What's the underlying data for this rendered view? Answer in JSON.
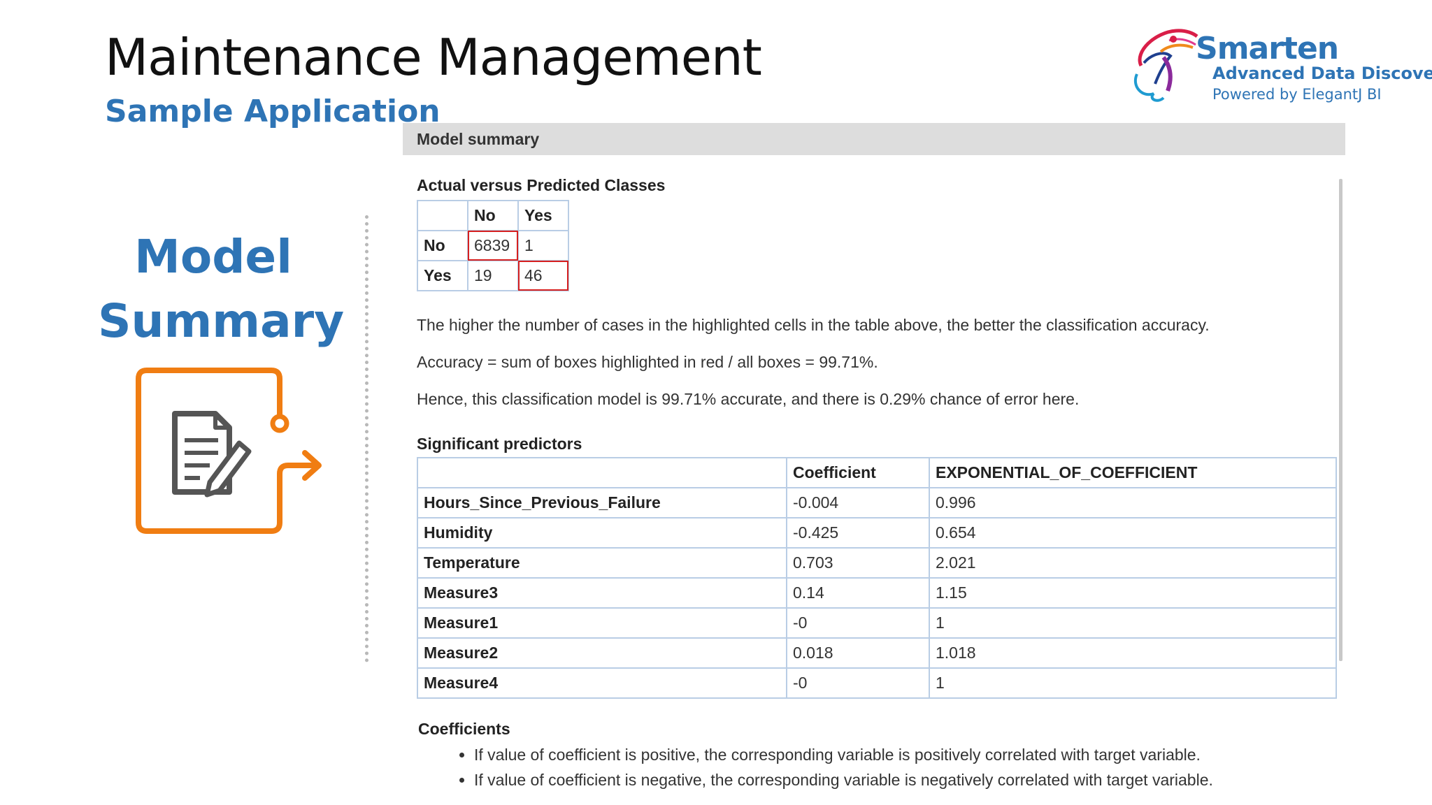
{
  "slide": {
    "title": "Maintenance Management",
    "subtitle": "Sample Application",
    "side_heading_line1": "Model",
    "side_heading_line2": "Summary"
  },
  "logo": {
    "name": "Smarten",
    "tagline": "Advanced Data Discovery",
    "powered_by": "Powered by ElegantJ BI"
  },
  "colors": {
    "accent_blue": "#2e74b5",
    "icon_orange": "#f07d12",
    "highlight_red": "#d62020",
    "table_border": "#b9cde5",
    "panel_header_bg": "#dddddd"
  },
  "icons": {
    "side": "document-edit-icon",
    "logo": "smarten-logo-mark"
  },
  "panel": {
    "header": "Model summary",
    "confusion": {
      "title": "Actual versus Predicted Classes",
      "columns": [
        "No",
        "Yes"
      ],
      "rows": [
        {
          "label": "No",
          "values": [
            "6839",
            "1"
          ]
        },
        {
          "label": "Yes",
          "values": [
            "19",
            "46"
          ]
        }
      ]
    },
    "explanation": [
      "The higher the number of cases in the highlighted cells in the table above, the better the classification accuracy.",
      "Accuracy = sum of boxes highlighted in red / all boxes = 99.71%.",
      "Hence, this classification model is 99.71% accurate, and there is 0.29% chance of error here."
    ],
    "predictors": {
      "title": "Significant predictors",
      "columns": [
        "",
        "Coefficient",
        "EXPONENTIAL_OF_COEFFICIENT"
      ],
      "rows": [
        {
          "name": "Hours_Since_Previous_Failure",
          "coefficient": "-0.004",
          "exp": "0.996"
        },
        {
          "name": "Humidity",
          "coefficient": "-0.425",
          "exp": "0.654"
        },
        {
          "name": "Temperature",
          "coefficient": "0.703",
          "exp": "2.021"
        },
        {
          "name": "Measure3",
          "coefficient": "0.14",
          "exp": "1.15"
        },
        {
          "name": "Measure1",
          "coefficient": "-0",
          "exp": "1"
        },
        {
          "name": "Measure2",
          "coefficient": "0.018",
          "exp": "1.018"
        },
        {
          "name": "Measure4",
          "coefficient": "-0",
          "exp": "1"
        }
      ]
    }
  },
  "coefficients": {
    "title": "Coefficients",
    "bullets": [
      "If value of coefficient is positive, the corresponding variable is positively correlated with target variable.",
      "If value of coefficient is negative, the corresponding variable is negatively correlated with target variable."
    ]
  }
}
